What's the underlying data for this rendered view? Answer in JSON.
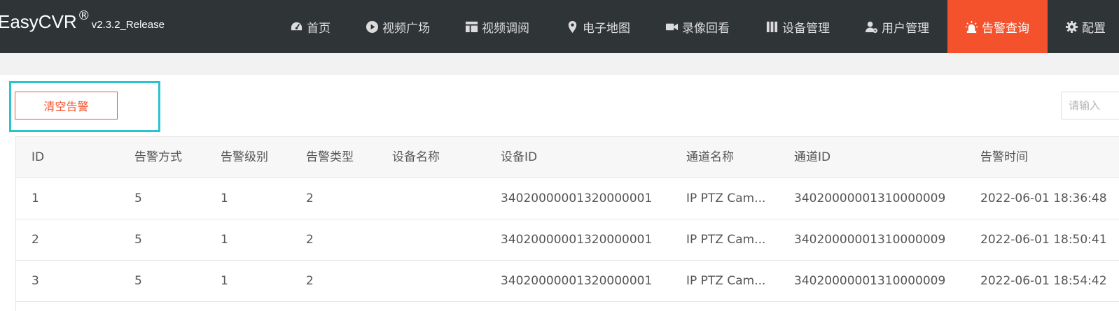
{
  "brand": {
    "name": "EasyCVR",
    "reg": "®",
    "version": "v2.3.2_Release"
  },
  "nav": {
    "items": [
      {
        "label": "首页",
        "icon": "dashboard-icon"
      },
      {
        "label": "视频广场",
        "icon": "play-circle-icon"
      },
      {
        "label": "视频调阅",
        "icon": "layout-icon"
      },
      {
        "label": "电子地图",
        "icon": "map-marker-icon"
      },
      {
        "label": "录像回看",
        "icon": "video-camera-icon"
      },
      {
        "label": "设备管理",
        "icon": "device-icon"
      },
      {
        "label": "用户管理",
        "icon": "user-gear-icon"
      },
      {
        "label": "告警查询",
        "icon": "alarm-light-icon",
        "active": true
      },
      {
        "label": "配置",
        "icon": "gear-icon"
      }
    ]
  },
  "toolbar": {
    "clear_label": "清空告警",
    "search_placeholder": "请输入"
  },
  "table": {
    "headers": [
      "ID",
      "告警方式",
      "告警级别",
      "告警类型",
      "设备名称",
      "设备ID",
      "通道名称",
      "通道ID",
      "告警时间"
    ],
    "rows": [
      [
        "1",
        "5",
        "1",
        "2",
        "",
        "34020000001320000001",
        "IP PTZ Cam...",
        "34020000001310000009",
        "2022-06-01 18:36:48"
      ],
      [
        "2",
        "5",
        "1",
        "2",
        "",
        "34020000001320000001",
        "IP PTZ Cam...",
        "34020000001310000009",
        "2022-06-01 18:50:41"
      ],
      [
        "3",
        "5",
        "1",
        "2",
        "",
        "34020000001320000001",
        "IP PTZ Cam...",
        "34020000001310000009",
        "2022-06-01 18:54:42"
      ]
    ]
  },
  "colors": {
    "navbar": "#2f3437",
    "accent": "#f4522d",
    "highlight": "#2ac4cf"
  }
}
